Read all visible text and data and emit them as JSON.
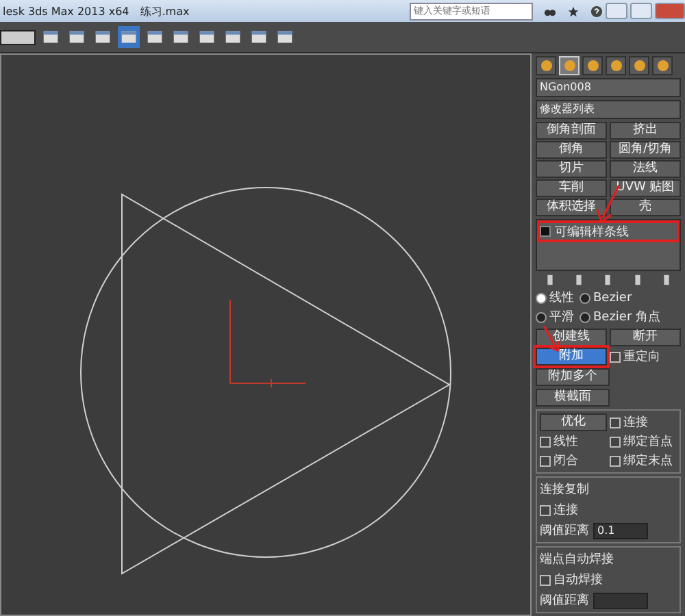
{
  "title_bar": {
    "title": "lesk 3ds Max 2013 x64",
    "file": "练习.max",
    "search": {
      "placeholder": "键入关键字或短语"
    }
  },
  "toolbar": {
    "buttons": [
      {
        "selected": false
      },
      {
        "selected": false
      },
      {
        "selected": false
      },
      {
        "selected": true
      },
      {
        "selected": false
      },
      {
        "selected": false
      },
      {
        "selected": false
      },
      {
        "selected": false
      },
      {
        "selected": false
      },
      {
        "selected": false
      }
    ]
  },
  "command_panel": {
    "tabs": [
      {
        "selected": false
      },
      {
        "selected": true
      },
      {
        "selected": false
      },
      {
        "selected": false
      },
      {
        "selected": false
      },
      {
        "selected": false
      }
    ],
    "object_name": "NGon008",
    "modifier_list": "修改器列表",
    "modifier_buttons": [
      "倒角剖面",
      "挤出",
      "倒角",
      "圆角/切角",
      "切片",
      "法线",
      "车削",
      "UVW 贴图",
      "体积选择",
      "壳"
    ],
    "stack": [
      {
        "label": "可编辑样条线",
        "highlighted": true
      }
    ],
    "rollout": {
      "radios": [
        {
          "label": "线性",
          "selected": true
        },
        {
          "label": "Bezier",
          "selected": false
        },
        {
          "label": "平滑",
          "selected": false
        },
        {
          "label": "Bezier 角点",
          "selected": false
        }
      ],
      "buttons": [
        {
          "label": "创建线",
          "selected": false,
          "highlighted": false
        },
        {
          "label": "断开",
          "selected": false,
          "highlighted": false
        },
        {
          "label": "附加",
          "selected": true,
          "highlighted": true
        }
      ],
      "reorient": {
        "label": "重定向",
        "checked": false
      },
      "attach_multiple": "附加多个",
      "cross_section": "横截面",
      "refine": {
        "button": "优化",
        "connect": {
          "label": "连接",
          "checked": false
        },
        "options": [
          {
            "label": "线性",
            "checked": false
          },
          {
            "label": "绑定首点",
            "checked": false
          },
          {
            "label": "闭合",
            "checked": false
          },
          {
            "label": "绑定末点",
            "checked": false
          }
        ]
      },
      "connect_copy": {
        "title": "连接复制",
        "connect": {
          "label": "连接",
          "checked": false
        },
        "threshold": {
          "label": "阈值距离",
          "value": "0.1"
        }
      },
      "weld": {
        "title": "端点自动焊接",
        "auto_weld": {
          "label": "自动焊接",
          "checked": false
        },
        "threshold": {
          "label": "阈值距离"
        }
      }
    }
  }
}
